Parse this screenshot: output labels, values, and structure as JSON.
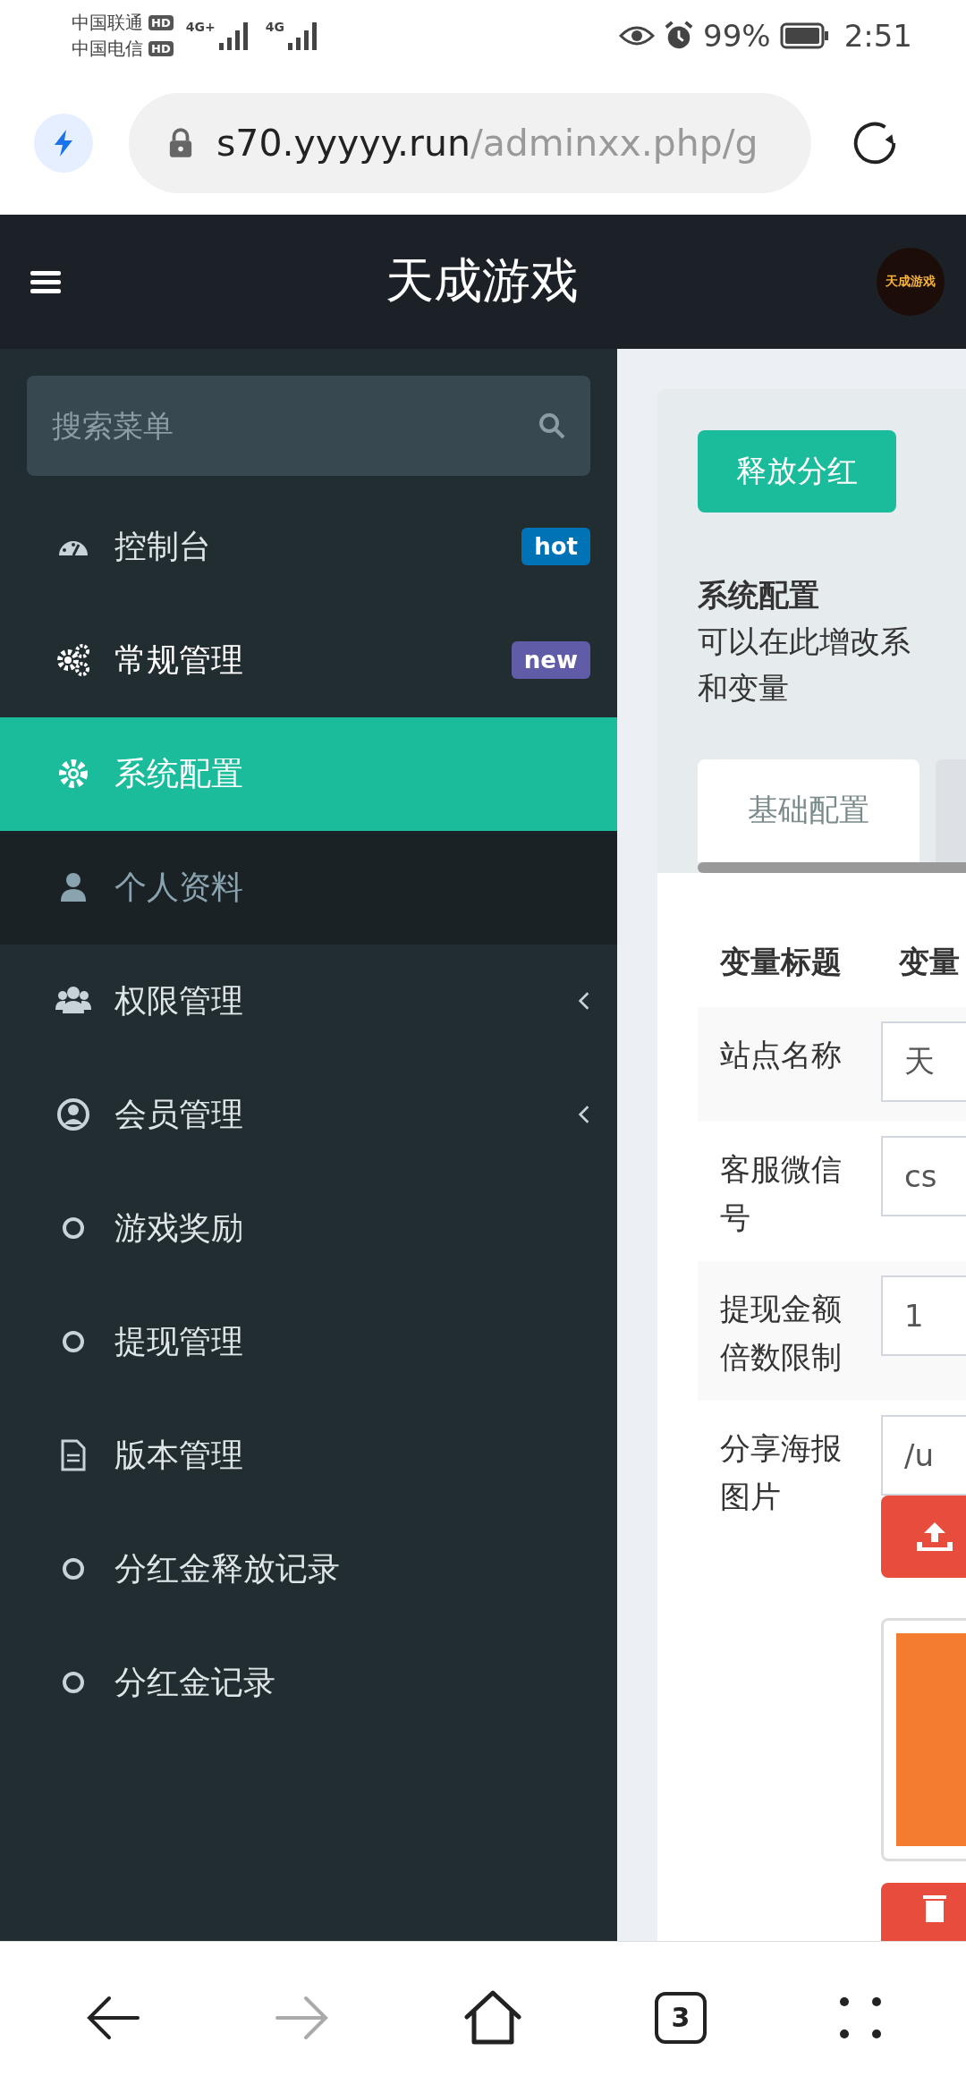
{
  "status_bar": {
    "carriers": [
      {
        "name": "中国联通",
        "badge": "HD",
        "network": "4G+"
      },
      {
        "name": "中国电信",
        "badge": "HD",
        "network": "4G"
      }
    ],
    "battery": "99%",
    "time": "2:51"
  },
  "browser": {
    "url_host": "s70.yyyyy.run",
    "url_path": "/adminxx.php/g",
    "tab_count": "3",
    "forward_disabled": true
  },
  "header": {
    "title": "天成游戏",
    "logo_text": "天成游戏"
  },
  "sidebar": {
    "search": {
      "placeholder": "搜索菜单"
    },
    "items": [
      {
        "label": "控制台",
        "kind": "link",
        "selected": false,
        "badge": {
          "text": "hot",
          "color": "#0073b7"
        }
      },
      {
        "label": "常规管理",
        "kind": "menu",
        "expanded": true,
        "selected": false,
        "badge": {
          "text": "new",
          "color": "#605ca8"
        },
        "children": [
          {
            "label": "系统配置",
            "selected": true
          },
          {
            "label": "个人资料",
            "selected": false
          }
        ]
      },
      {
        "label": "权限管理",
        "kind": "menu",
        "expanded": false,
        "selected": false
      },
      {
        "label": "会员管理",
        "kind": "menu",
        "expanded": false,
        "selected": false
      },
      {
        "label": "游戏奖励",
        "kind": "link",
        "selected": false
      },
      {
        "label": "提现管理",
        "kind": "link",
        "selected": false
      },
      {
        "label": "版本管理",
        "kind": "link",
        "selected": false
      },
      {
        "label": "分红金释放记录",
        "kind": "link",
        "selected": false
      },
      {
        "label": "分红金记录",
        "kind": "link",
        "selected": false
      }
    ]
  },
  "content": {
    "action_button": "释放分红",
    "title": "系统配置",
    "description_lines": [
      "可以在此增改系",
      "和变量"
    ],
    "tabs": [
      {
        "label": "基础配置",
        "selected": true
      }
    ],
    "table": {
      "columns": [
        "变量标题",
        "变量"
      ],
      "rows": [
        {
          "label": "站点名称",
          "value": "天",
          "kind": "text"
        },
        {
          "label": "客服微信号",
          "value": "cs",
          "kind": "text"
        },
        {
          "label": "提现金额倍数限制",
          "value": "1",
          "kind": "text"
        },
        {
          "label": "分享海报图片",
          "value": "/u",
          "kind": "image"
        }
      ]
    }
  }
}
